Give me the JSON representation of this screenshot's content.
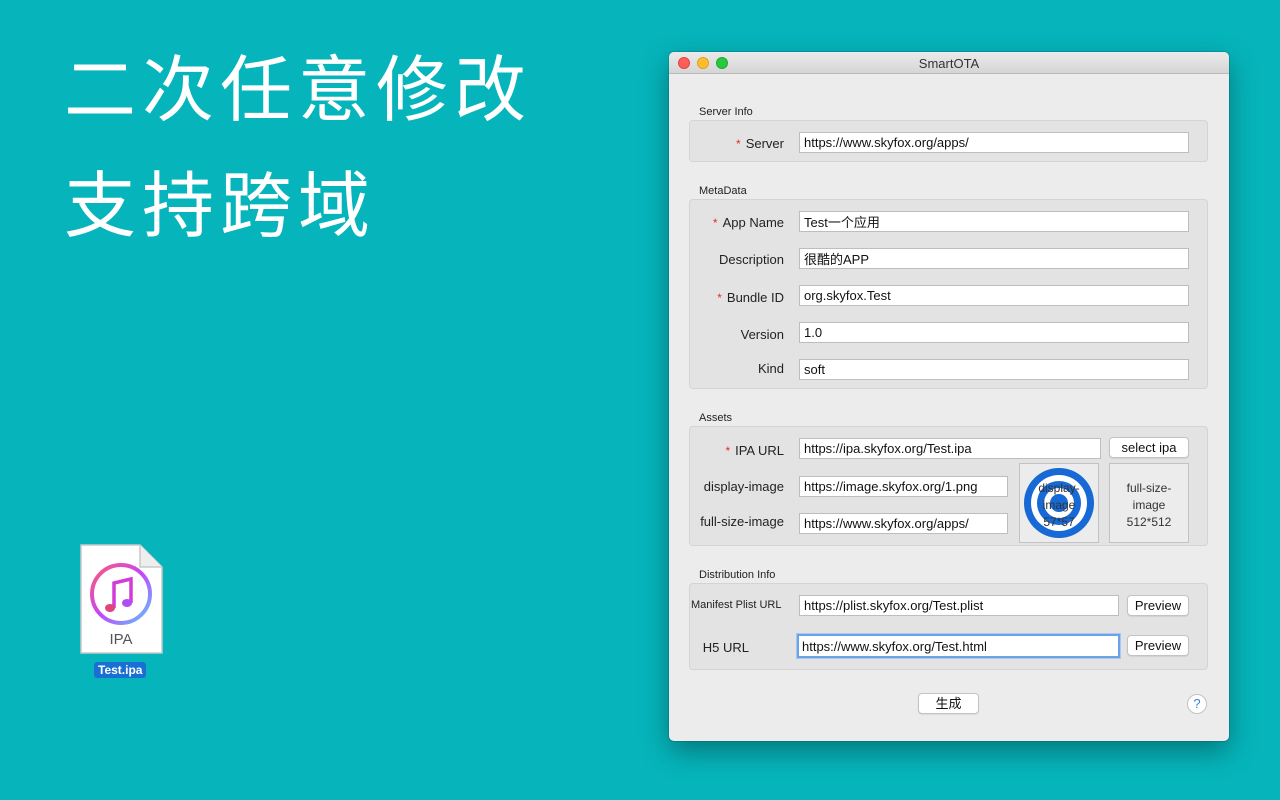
{
  "headline": {
    "line1": "二次任意修改",
    "line2": "支持跨域"
  },
  "desktop_file": {
    "badge": "IPA",
    "name": "Test.ipa"
  },
  "window": {
    "title": "SmartOTA",
    "server_info": {
      "heading": "Server Info",
      "server": {
        "label": "Server",
        "required": "*",
        "value": "https://www.skyfox.org/apps/"
      }
    },
    "metadata": {
      "heading": "MetaData",
      "app_name": {
        "label": "App Name",
        "required": "*",
        "value": "Test一个应用"
      },
      "description": {
        "label": "Description",
        "value": "很酷的APP"
      },
      "bundle_id": {
        "label": "Bundle ID",
        "required": "*",
        "value": "org.skyfox.Test"
      },
      "version": {
        "label": "Version",
        "value": "1.0"
      },
      "kind": {
        "label": "Kind",
        "value": "soft"
      }
    },
    "assets": {
      "heading": "Assets",
      "ipa_url": {
        "label": "IPA URL",
        "required": "*",
        "value": "https://ipa.skyfox.org/Test.ipa"
      },
      "select_ipa": "select ipa",
      "display_image": {
        "label": "display-image",
        "value": "https://image.skyfox.org/1.png"
      },
      "full_size_image": {
        "label": "full-size-image",
        "value": "https://www.skyfox.org/apps/"
      },
      "display_preview": {
        "line1": "display-",
        "line2": "image",
        "line3": "57*57"
      },
      "full_size_preview": {
        "line1": "full-size-",
        "line2": "image",
        "line3": "512*512"
      }
    },
    "distribution": {
      "heading": "Distribution Info",
      "manifest": {
        "label": "Manifest Plist URL",
        "value": "https://plist.skyfox.org/Test.plist",
        "button": "Preview"
      },
      "h5": {
        "label": "H5 URL",
        "value": "https://www.skyfox.org/Test.html",
        "button": "Preview"
      }
    },
    "generate_button": "生成",
    "help_button": "?"
  },
  "colors": {
    "background": "#05b5bb",
    "required": "#e0312b",
    "focus": "#6aa3e8",
    "badge": "#1a6fd4"
  }
}
